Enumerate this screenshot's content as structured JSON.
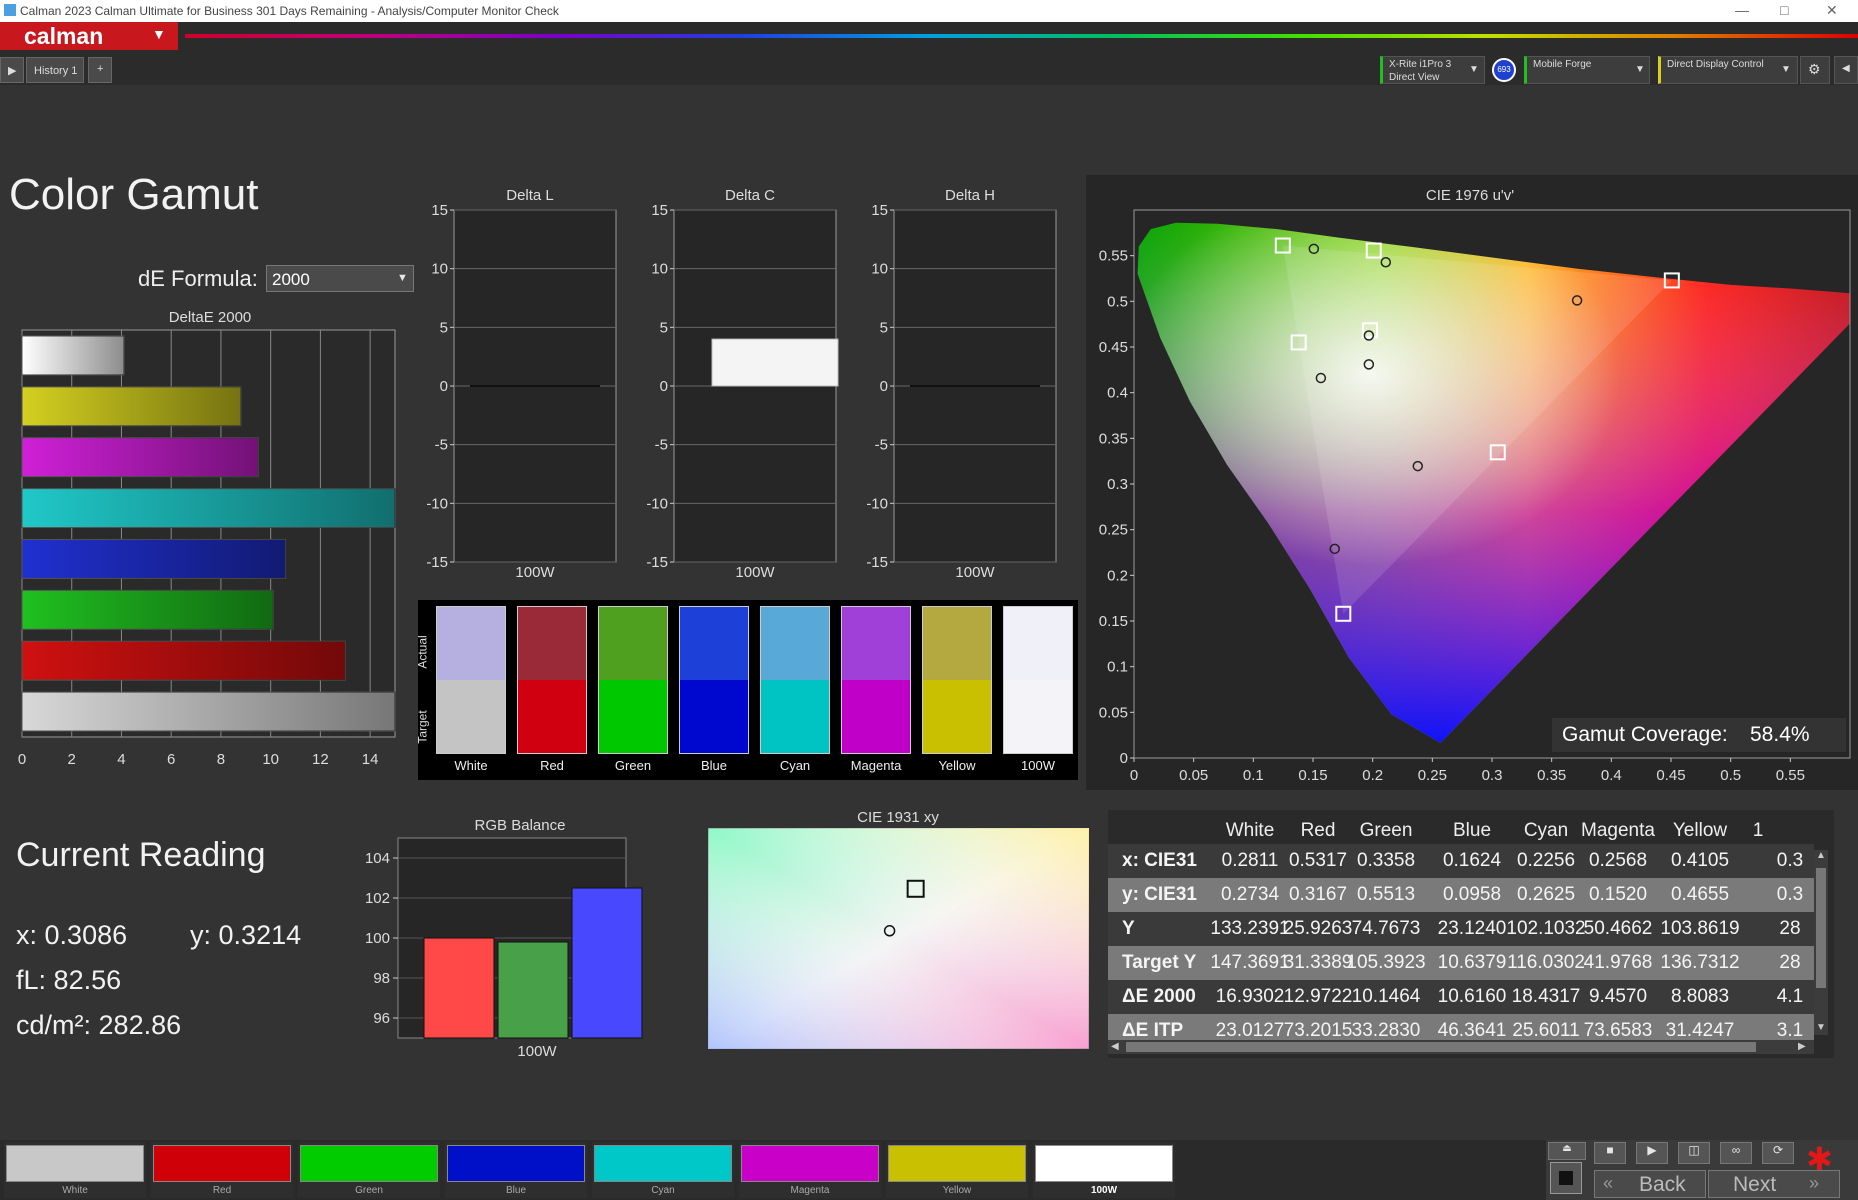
{
  "window": {
    "title": "Calman 2023 Calman Ultimate for Business 301 Days Remaining  -  Analysis/Computer Monitor Check"
  },
  "app": {
    "logo": "calman",
    "history_tab": "History 1",
    "add_tab": "+"
  },
  "devices": {
    "meter_line1": "X-Rite i1Pro 3",
    "meter_line2": "Direct View",
    "meter_badge": "693",
    "source": "Mobile Forge",
    "display": "Direct Display Control"
  },
  "page": {
    "title": "Color Gamut",
    "de_formula_label": "dE Formula:",
    "de_formula_value": "2000"
  },
  "deltae_chart": {
    "title": "DeltaE 2000",
    "xticks": [
      "0",
      "2",
      "4",
      "6",
      "8",
      "10",
      "12",
      "14"
    ],
    "xlim": [
      0,
      15
    ],
    "bars": [
      {
        "name": "White",
        "value": 4.1,
        "color": "#ffffff"
      },
      {
        "name": "Yellow",
        "value": 8.8,
        "color": "#d4d020"
      },
      {
        "name": "Magenta",
        "value": 9.5,
        "color": "#d020d8"
      },
      {
        "name": "Cyan",
        "value": 18.4,
        "color": "#20c8c8"
      },
      {
        "name": "Blue",
        "value": 10.6,
        "color": "#2030d0"
      },
      {
        "name": "Green",
        "value": 10.1,
        "color": "#20c020"
      },
      {
        "name": "Red",
        "value": 13.0,
        "color": "#d01010"
      },
      {
        "name": "100W",
        "value": 16.9,
        "color": "#d8d8d8"
      }
    ]
  },
  "delta_charts": [
    {
      "title": "Delta L",
      "xlabel": "100W",
      "value": 0
    },
    {
      "title": "Delta C",
      "xlabel": "100W",
      "value": 4
    },
    {
      "title": "Delta H",
      "xlabel": "100W",
      "value": 0
    }
  ],
  "delta_yticks": [
    "15",
    "10",
    "5",
    "0",
    "-5",
    "-10",
    "-15"
  ],
  "swatches": {
    "actual_label": "Actual",
    "target_label": "Target",
    "items": [
      {
        "name": "White",
        "actual": "#b6b0e0",
        "target": "#c4c4c4"
      },
      {
        "name": "Red",
        "actual": "#9a2a38",
        "target": "#d00010"
      },
      {
        "name": "Green",
        "actual": "#50a020",
        "target": "#00c800"
      },
      {
        "name": "Blue",
        "actual": "#1c40d8",
        "target": "#0008d0"
      },
      {
        "name": "Cyan",
        "actual": "#58a8d8",
        "target": "#00c4c4"
      },
      {
        "name": "Magenta",
        "actual": "#a040d8",
        "target": "#c000c8"
      },
      {
        "name": "Yellow",
        "actual": "#b4a840",
        "target": "#c8c000"
      },
      {
        "name": "100W",
        "actual": "#f0f0f8",
        "target": "#f4f4f8"
      }
    ]
  },
  "cie1976": {
    "title": "CIE 1976 u'v'",
    "xticks": [
      "0",
      "0.05",
      "0.1",
      "0.15",
      "0.2",
      "0.25",
      "0.3",
      "0.35",
      "0.4",
      "0.45",
      "0.5",
      "0.55"
    ],
    "yticks": [
      "0",
      "0.05",
      "0.1",
      "0.15",
      "0.2",
      "0.25",
      "0.3",
      "0.35",
      "0.4",
      "0.45",
      "0.5",
      "0.55"
    ],
    "xlim": [
      0,
      0.6
    ],
    "ylim": [
      0,
      0.6
    ],
    "gamut_label": "Gamut Coverage:",
    "gamut_value": "58.4%",
    "targets": [
      [
        0.1247,
        0.5611
      ],
      [
        0.2009,
        0.5556
      ],
      [
        0.4507,
        0.5229
      ],
      [
        0.3048,
        0.3347
      ],
      [
        0.1754,
        0.1579
      ],
      [
        0.138,
        0.455
      ],
      [
        0.1978,
        0.4683
      ]
    ],
    "measured": [
      [
        0.1507,
        0.5575
      ],
      [
        0.211,
        0.5428
      ],
      [
        0.3713,
        0.501
      ],
      [
        0.2378,
        0.3196
      ],
      [
        0.1682,
        0.229
      ],
      [
        0.1566,
        0.416
      ],
      [
        0.1968,
        0.431
      ],
      [
        0.1968,
        0.4626
      ]
    ]
  },
  "current_reading": {
    "title": "Current Reading",
    "x_label": "x:",
    "x": "0.3086",
    "y_label": "y:",
    "y": "0.3214",
    "fl_label": "fL:",
    "fl": "82.56",
    "cd_label": "cd/m²:",
    "cd": "282.86"
  },
  "rgb_balance": {
    "title": "RGB Balance",
    "xlabel": "100W",
    "yticks": [
      "104",
      "102",
      "100",
      "98",
      "96"
    ],
    "ylim": [
      95,
      105
    ],
    "values": [
      {
        "name": "R",
        "value": 100.0,
        "color": "#ff4848"
      },
      {
        "name": "G",
        "value": 99.8,
        "color": "#48a048"
      },
      {
        "name": "B",
        "value": 102.5,
        "color": "#4848ff"
      }
    ]
  },
  "cie1931": {
    "title": "CIE 1931 xy",
    "target": [
      0.3127,
      0.329
    ],
    "measured": [
      0.3086,
      0.3214
    ],
    "xlim": [
      0.28,
      0.34
    ],
    "ylim": [
      0.3,
      0.34
    ]
  },
  "table": {
    "headers": [
      "",
      "White",
      "Red",
      "Green",
      "Blue",
      "Cyan",
      "Magenta",
      "Yellow",
      "1"
    ],
    "rows": [
      {
        "label": "x: CIE31",
        "cells": [
          "0.2811",
          "0.5317",
          "0.3358",
          "0.1624",
          "0.2256",
          "0.2568",
          "0.4105",
          "0.3"
        ]
      },
      {
        "label": "y: CIE31",
        "cells": [
          "0.2734",
          "0.3167",
          "0.5513",
          "0.0958",
          "0.2625",
          "0.1520",
          "0.4655",
          "0.3"
        ]
      },
      {
        "label": "Y",
        "cells": [
          "133.2391",
          "25.9263",
          "74.7673",
          "23.1240",
          "102.1032",
          "50.4662",
          "103.8619",
          "28"
        ]
      },
      {
        "label": "Target Y",
        "cells": [
          "147.3691",
          "31.3389",
          "105.3923",
          "10.6379",
          "116.0302",
          "41.9768",
          "136.7312",
          "28"
        ]
      },
      {
        "label": "ΔE 2000",
        "cells": [
          "16.9302",
          "12.9722",
          "10.1464",
          "10.6160",
          "18.4317",
          "9.4570",
          "8.8083",
          "4.1"
        ]
      },
      {
        "label": "ΔE ITP",
        "cells": [
          "23.0127",
          "73.2015",
          "33.2830",
          "46.3641",
          "25.6011",
          "73.6583",
          "31.4247",
          "3.1"
        ]
      }
    ]
  },
  "bottom_swatches": [
    {
      "name": "White",
      "color": "#c8c8c8"
    },
    {
      "name": "Red",
      "color": "#d00008"
    },
    {
      "name": "Green",
      "color": "#00cc00"
    },
    {
      "name": "Blue",
      "color": "#0010c8"
    },
    {
      "name": "Cyan",
      "color": "#00c8c8"
    },
    {
      "name": "Magenta",
      "color": "#c800c8"
    },
    {
      "name": "Yellow",
      "color": "#c8c000"
    },
    {
      "name": "100W",
      "color": "#ffffff"
    }
  ],
  "nav": {
    "back": "Back",
    "next": "Next"
  }
}
